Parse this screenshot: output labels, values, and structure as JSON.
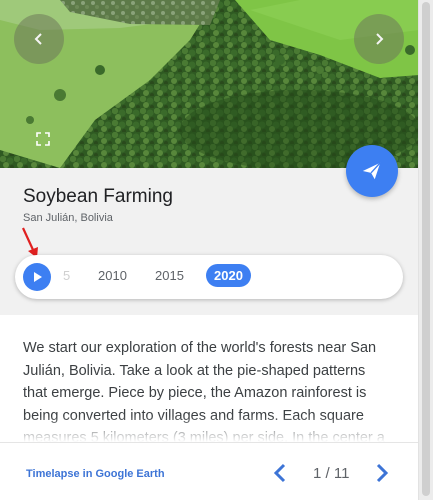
{
  "photo": {
    "prev_icon": "chevron-left-icon",
    "next_icon": "chevron-right-icon",
    "fullscreen_icon": "fullscreen-icon",
    "share_icon": "send-icon"
  },
  "story": {
    "title": "Soybean Farming",
    "location": "San Julián, Bolivia"
  },
  "timeline": {
    "play_icon": "play-icon",
    "years": [
      "5",
      "2010",
      "2015",
      "2020"
    ],
    "selected_year": "2020"
  },
  "description": {
    "text": "We start our exploration of the world's forests near San Julián, Bolivia. Take a look at the pie-shaped patterns that emerge. Piece by piece, the Amazon rainforest is being converted into villages and farms. Each square measures 5 kilometers (3 miles) per side. In the center a small village"
  },
  "footer": {
    "link_label": "Timelapse in Google Earth",
    "pager": "1 / 11"
  },
  "colors": {
    "accent": "#3d7ff2",
    "annotation_arrow": "#e02020"
  }
}
